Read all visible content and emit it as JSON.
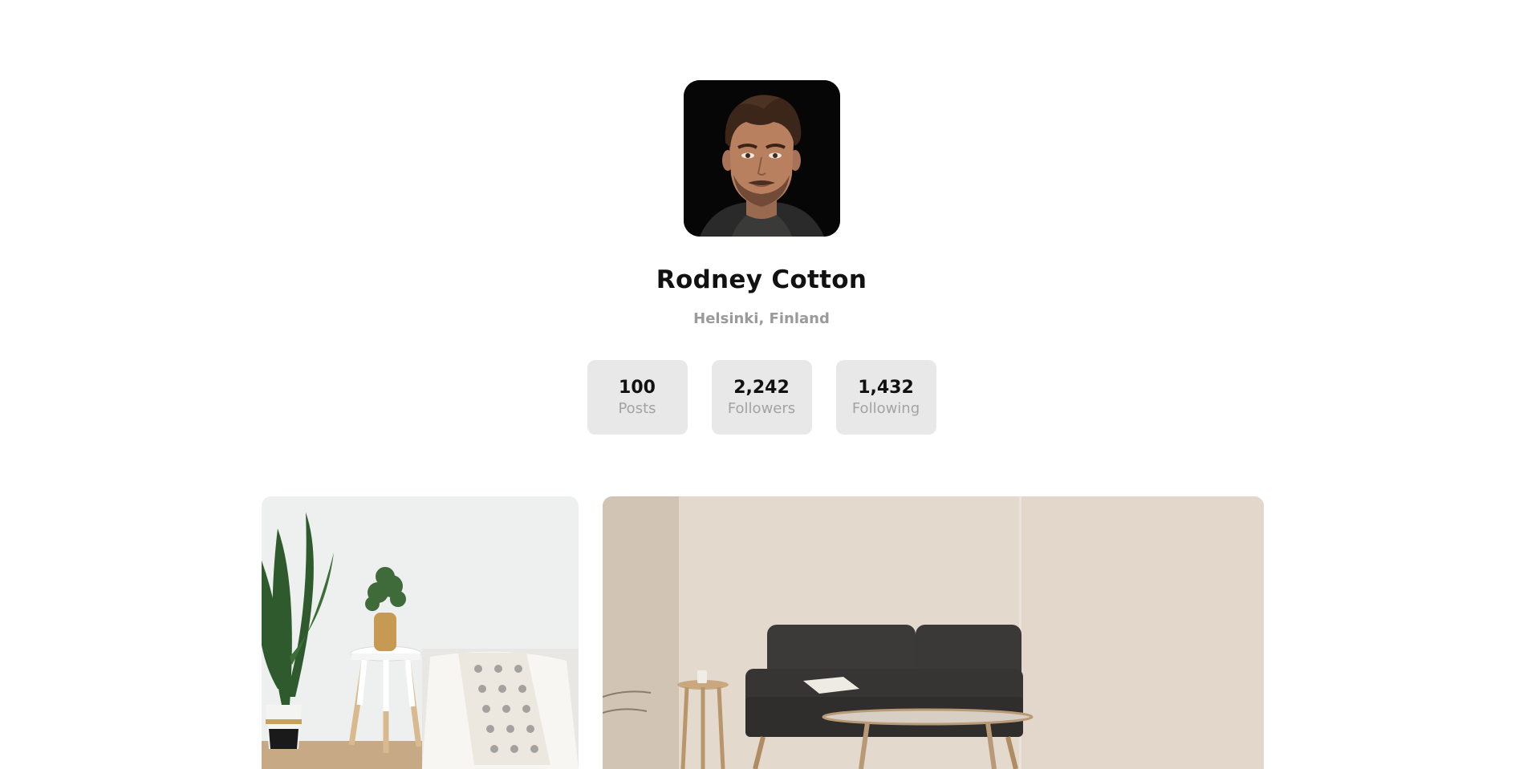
{
  "profile": {
    "name": "Rodney Cotton",
    "location": "Helsinki, Finland",
    "avatar_icon": "portrait-photo"
  },
  "stats": [
    {
      "value": "100",
      "label": "Posts"
    },
    {
      "value": "2,242",
      "label": "Followers"
    },
    {
      "value": "1,432",
      "label": "Following"
    }
  ],
  "gallery": {
    "photos": [
      {
        "icon": "living-room-plant-photo"
      },
      {
        "icon": "living-room-sofa-photo"
      }
    ]
  },
  "colors": {
    "background": "#ffffff",
    "stat_background": "#e8e8e8",
    "muted_text": "#9a9a9a",
    "primary_text": "#111111"
  }
}
